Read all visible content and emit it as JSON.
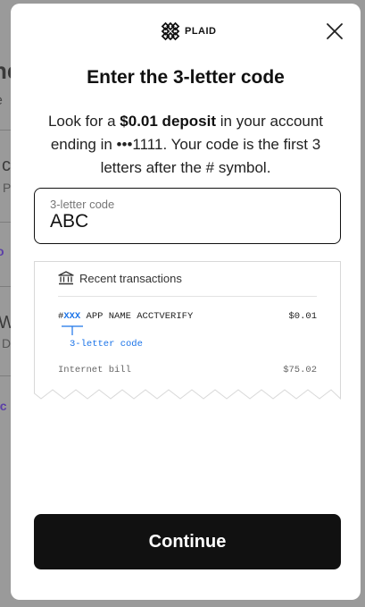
{
  "background": {
    "fragments": [
      "he",
      "e",
      "c",
      "P",
      "o",
      "W",
      "D",
      "cc"
    ]
  },
  "modal": {
    "logo_text": "PLAID",
    "title": "Enter the 3-letter code",
    "description": {
      "part1": "Look for a ",
      "bold": "$0.01 deposit",
      "part2": " in your account ending in •••1111. Your code is the first 3 letters after the # symbol."
    },
    "code_field": {
      "label": "3-letter code",
      "value": "ABC"
    },
    "receipt": {
      "title": "Recent transactions",
      "rows": [
        {
          "hash": "#",
          "code": "XXX",
          "description": " APP NAME ACCTVERIFY",
          "amount": "$0.01"
        },
        {
          "description": "Internet bill",
          "amount": "$75.02"
        }
      ],
      "annotation": "3-letter code"
    },
    "continue_label": "Continue"
  }
}
